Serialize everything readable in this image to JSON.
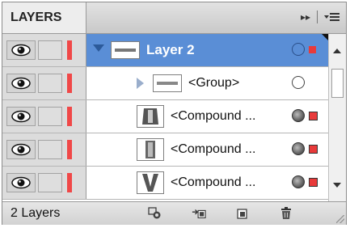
{
  "panel": {
    "tab_title": "LAYERS",
    "collapse_label": "▸▸"
  },
  "rows": [
    {
      "name": "Layer 2",
      "selected": true,
      "disclosure": "expanded",
      "thumb": "layer-thumbnail"
    },
    {
      "name": "<Group>",
      "selected": false,
      "disclosure": "collapsed",
      "thumb": "group-thumbnail"
    },
    {
      "name": "<Compound ...",
      "selected": false,
      "disclosure": "none",
      "thumb": "compound-path-thumbnail"
    },
    {
      "name": "<Compound ...",
      "selected": false,
      "disclosure": "none",
      "thumb": "compound-path-thumbnail"
    },
    {
      "name": "<Compound ...",
      "selected": false,
      "disclosure": "none",
      "thumb": "compound-path-thumbnail"
    }
  ],
  "footer": {
    "count": "2 Layers"
  },
  "colors": {
    "layer_color": "#f04848",
    "selection_highlight": "#5a8ed6"
  }
}
